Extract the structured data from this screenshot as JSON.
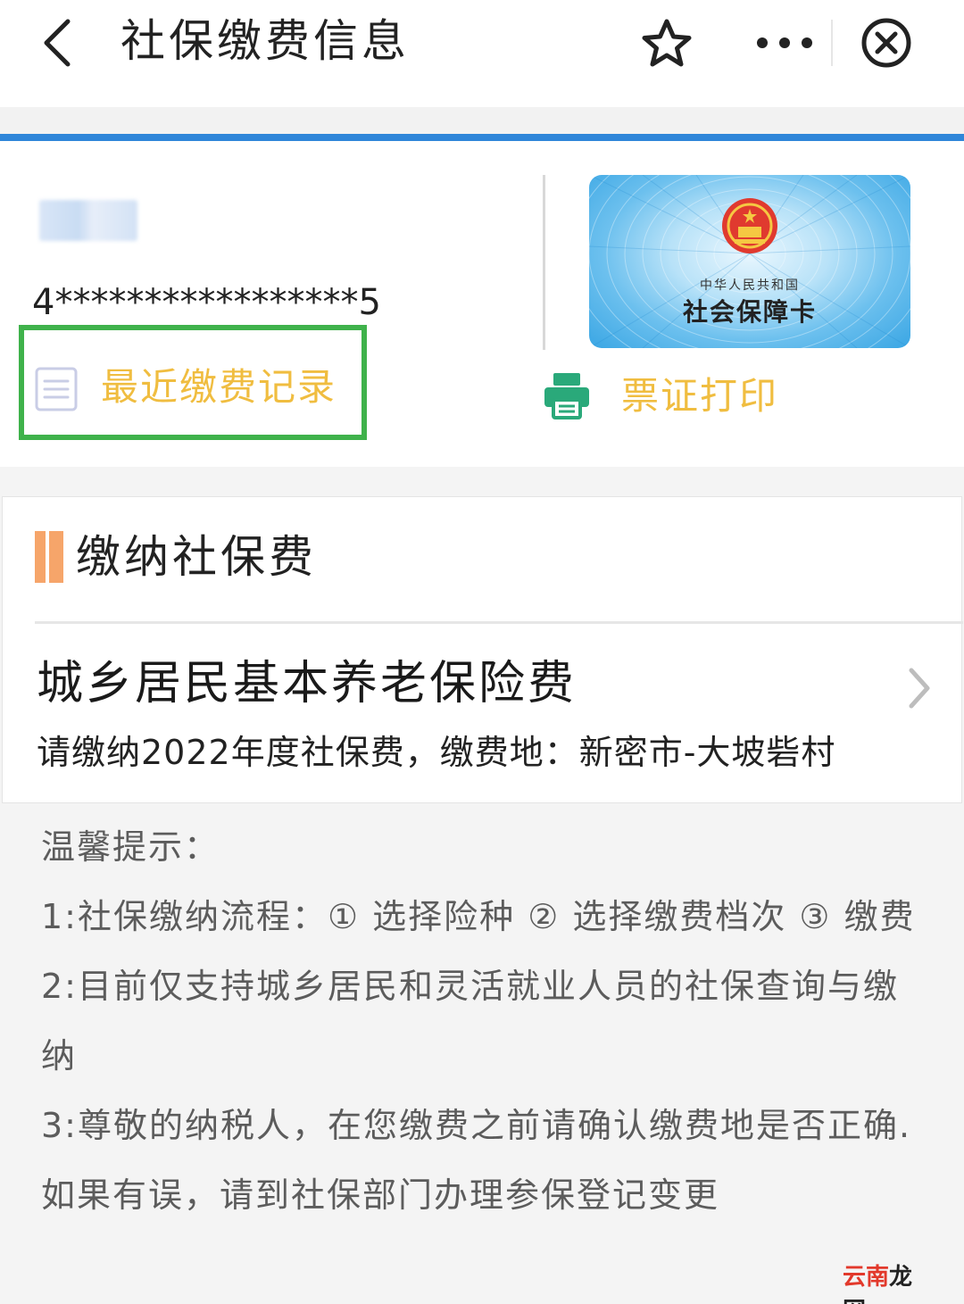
{
  "header": {
    "title": "社保缴费信息"
  },
  "profile": {
    "id_number": "4*****************5"
  },
  "card": {
    "subtitle": "中华人民共和国",
    "title": "社会保障卡"
  },
  "actions": {
    "recent_records_label": "最近缴费记录",
    "print_label": "票证打印"
  },
  "pay_section": {
    "title": "缴纳社保费",
    "item": {
      "name": "城乡居民基本养老保险费",
      "description": "请缴纳2022年度社保费，缴费地：新密市-大坡砦村"
    }
  },
  "tips": {
    "title": "温馨提示：",
    "lines": [
      "1:社保缴纳流程：① 选择险种 ② 选择缴费档次 ③ 缴费",
      "2:目前仅支持城乡居民和灵活就业人员的社保查询与缴",
      "纳",
      "3:尊敬的纳税人，在您缴费之前请确认缴费地是否正确.",
      "如果有误，请到社保部门办理参保登记变更"
    ]
  },
  "watermark": {
    "part1": "云南",
    "part2": "龙网"
  },
  "colors": {
    "accent_blue": "#2f86d9",
    "highlight_green": "#3fb24b",
    "action_yellow": "#f0bd40",
    "section_orange": "#f6a56a"
  }
}
